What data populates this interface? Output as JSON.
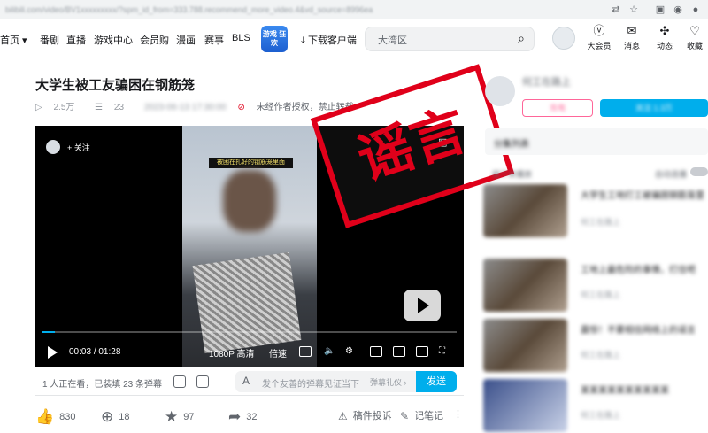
{
  "browser": {
    "url": "bilibili.com/video/BV1xxxxxxxxx/?spm_id_from=333.788.recommend_more_video.4&vd_source=8996ea"
  },
  "nav": {
    "items": [
      "首页",
      "番剧",
      "直播",
      "游戏中心",
      "会员购",
      "漫画",
      "赛事",
      "BLS"
    ],
    "logo_text": "游戏 狂欢",
    "download_label": "下载客户端",
    "search_placeholder": "大湾区",
    "right_icons": [
      {
        "label": "大会员",
        "icon": "vip-icon"
      },
      {
        "label": "消息",
        "icon": "message-icon"
      },
      {
        "label": "动态",
        "icon": "dynamic-icon"
      },
      {
        "label": "收藏",
        "icon": "favorite-icon"
      }
    ]
  },
  "video": {
    "title": "大学生被工友骗困在钢筋笼",
    "views": "2.5万",
    "danmaku_count": "23",
    "notice": "未经作者授权，禁止转载",
    "follow_label": "关注",
    "caption": "被困在扎好的钢筋笼里面",
    "time_current": "00:03",
    "time_total": "01:28",
    "time_sep": "/",
    "progress": 0.03,
    "quality": "1080P 高清",
    "speed": "倍速",
    "stamp_text": "谣言"
  },
  "danmaku": {
    "watching": "1 人正在看，已装填 23 条弹幕",
    "placeholder": "发个友善的弹幕见证当下",
    "gift": "弹幕礼仪 ›",
    "send": "发送"
  },
  "actions": {
    "like": "830",
    "coin": "18",
    "favorite": "97",
    "share": "32",
    "report": "稿件投诉",
    "note": "记笔记"
  },
  "sidebar": {
    "uploader": "何工在路上",
    "charge": "充电",
    "follow": "关注 1.3万",
    "playlist": "分集列表",
    "autoplay": "自动连播",
    "next_label": "接下来播放",
    "recs": [
      {
        "title": "大学生工地打工被骗困钢筋笼里",
        "meta": "何工在路上"
      },
      {
        "title": "工地上最危险的事情，打住吧",
        "meta": "何工在路上"
      },
      {
        "title": "震惊！不要相信网络上的谣言",
        "meta": "何工在路上"
      },
      {
        "title": "某某某某某某某某某某",
        "meta": "何工在路上"
      }
    ]
  }
}
